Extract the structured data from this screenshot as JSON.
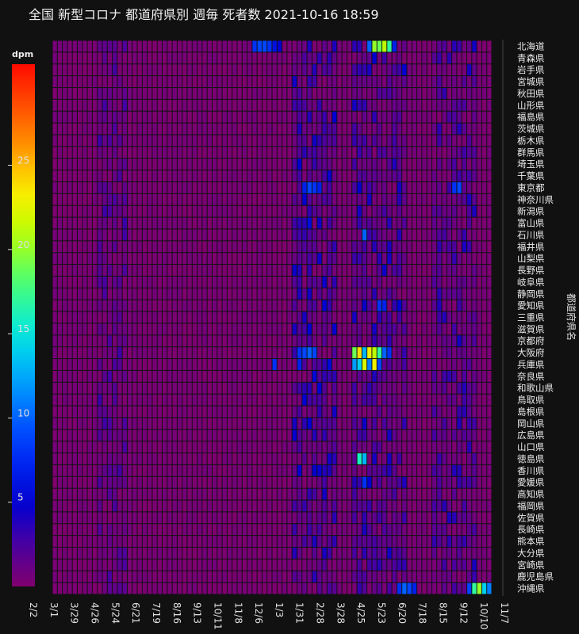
{
  "chart_data": {
    "type": "heatmap",
    "title": "全国 新型コロナ 都道府県別 週毎 死者数  2021-10-16 18:59",
    "xlabel": "",
    "ylabel": "都道府県名",
    "colorbar": {
      "title": "dpm",
      "range": [
        0,
        31
      ],
      "ticks": [
        5,
        10,
        15,
        20,
        25
      ],
      "colorscale": "jet-like (purple → blue → cyan → green → yellow → red)"
    },
    "x_tick_labels": [
      "2/2",
      "3/1",
      "3/29",
      "4/26",
      "5/24",
      "6/21",
      "7/19",
      "8/16",
      "9/13",
      "10/11",
      "11/8",
      "12/6",
      "1/3",
      "1/31",
      "2/28",
      "3/28",
      "4/25",
      "5/23",
      "6/20",
      "7/18",
      "8/15",
      "9/12",
      "10/10",
      "11/7"
    ],
    "n_weeks": 88,
    "prefectures": [
      "北海道",
      "青森県",
      "岩手県",
      "宮城県",
      "秋田県",
      "山形県",
      "福島県",
      "茨城県",
      "栃木県",
      "群馬県",
      "埼玉県",
      "千葉県",
      "東京都",
      "神奈川県",
      "新潟県",
      "富山県",
      "石川県",
      "福井県",
      "山梨県",
      "長野県",
      "岐阜県",
      "静岡県",
      "愛知県",
      "三重県",
      "滋賀県",
      "京都府",
      "大阪府",
      "兵庫県",
      "奈良県",
      "和歌山県",
      "鳥取県",
      "島根県",
      "岡山県",
      "広島県",
      "山口県",
      "徳島県",
      "香川県",
      "愛媛県",
      "高知県",
      "福岡県",
      "佐賀県",
      "長崎県",
      "熊本県",
      "大分県",
      "宮崎県",
      "鹿児島県",
      "沖縄県"
    ],
    "hotspots": [
      {
        "prefecture": "北海道",
        "week": 40,
        "value": 8
      },
      {
        "prefecture": "北海道",
        "week": 41,
        "value": 9
      },
      {
        "prefecture": "北海道",
        "week": 42,
        "value": 9
      },
      {
        "prefecture": "北海道",
        "week": 43,
        "value": 8
      },
      {
        "prefecture": "北海道",
        "week": 44,
        "value": 6
      },
      {
        "prefecture": "北海道",
        "week": 45,
        "value": 5
      },
      {
        "prefecture": "北海道",
        "week": 64,
        "value": 20
      },
      {
        "prefecture": "北海道",
        "week": 65,
        "value": 19
      },
      {
        "prefecture": "北海道",
        "week": 66,
        "value": 21
      },
      {
        "prefecture": "北海道",
        "week": 67,
        "value": 17
      },
      {
        "prefecture": "北海道",
        "week": 63,
        "value": 10
      },
      {
        "prefecture": "北海道",
        "week": 68,
        "value": 7
      },
      {
        "prefecture": "東京都",
        "week": 50,
        "value": 7
      },
      {
        "prefecture": "東京都",
        "week": 51,
        "value": 9
      },
      {
        "prefecture": "東京都",
        "week": 52,
        "value": 8
      },
      {
        "prefecture": "東京都",
        "week": 53,
        "value": 7
      },
      {
        "prefecture": "東京都",
        "week": 80,
        "value": 8
      },
      {
        "prefecture": "東京都",
        "week": 81,
        "value": 9
      },
      {
        "prefecture": "石川県",
        "week": 62,
        "value": 10
      },
      {
        "prefecture": "愛知県",
        "week": 65,
        "value": 8
      },
      {
        "prefecture": "愛知県",
        "week": 66,
        "value": 7
      },
      {
        "prefecture": "大阪府",
        "week": 49,
        "value": 8
      },
      {
        "prefecture": "大阪府",
        "week": 50,
        "value": 9
      },
      {
        "prefecture": "大阪府",
        "week": 51,
        "value": 10
      },
      {
        "prefecture": "大阪府",
        "week": 52,
        "value": 9
      },
      {
        "prefecture": "大阪府",
        "week": 60,
        "value": 19
      },
      {
        "prefecture": "大阪府",
        "week": 61,
        "value": 24
      },
      {
        "prefecture": "大阪府",
        "week": 62,
        "value": 13
      },
      {
        "prefecture": "大阪府",
        "week": 63,
        "value": 23
      },
      {
        "prefecture": "大阪府",
        "week": 64,
        "value": 21
      },
      {
        "prefecture": "大阪府",
        "week": 65,
        "value": 17
      },
      {
        "prefecture": "大阪府",
        "week": 66,
        "value": 10
      },
      {
        "prefecture": "大阪府",
        "week": 67,
        "value": 8
      },
      {
        "prefecture": "兵庫県",
        "week": 44,
        "value": 8
      },
      {
        "prefecture": "兵庫県",
        "week": 49,
        "value": 7
      },
      {
        "prefecture": "兵庫県",
        "week": 60,
        "value": 12
      },
      {
        "prefecture": "兵庫県",
        "week": 61,
        "value": 14
      },
      {
        "prefecture": "兵庫県",
        "week": 62,
        "value": 22
      },
      {
        "prefecture": "兵庫県",
        "week": 63,
        "value": 11
      },
      {
        "prefecture": "兵庫県",
        "week": 64,
        "value": 23
      },
      {
        "prefecture": "兵庫県",
        "week": 65,
        "value": 9
      },
      {
        "prefecture": "徳島県",
        "week": 61,
        "value": 16
      },
      {
        "prefecture": "徳島県",
        "week": 62,
        "value": 13
      },
      {
        "prefecture": "愛媛県",
        "week": 62,
        "value": 8
      },
      {
        "prefecture": "沖縄県",
        "week": 69,
        "value": 8
      },
      {
        "prefecture": "沖縄県",
        "week": 70,
        "value": 10
      },
      {
        "prefecture": "沖縄県",
        "week": 71,
        "value": 9
      },
      {
        "prefecture": "沖縄県",
        "week": 72,
        "value": 7
      },
      {
        "prefecture": "沖縄県",
        "week": 83,
        "value": 9
      },
      {
        "prefecture": "沖縄県",
        "week": 84,
        "value": 17
      },
      {
        "prefecture": "沖縄県",
        "week": 85,
        "value": 20
      },
      {
        "prefecture": "沖縄県",
        "week": 86,
        "value": 14
      },
      {
        "prefecture": "沖縄県",
        "week": 87,
        "value": 11
      }
    ],
    "grid": false,
    "legend": "colorbar-left"
  }
}
